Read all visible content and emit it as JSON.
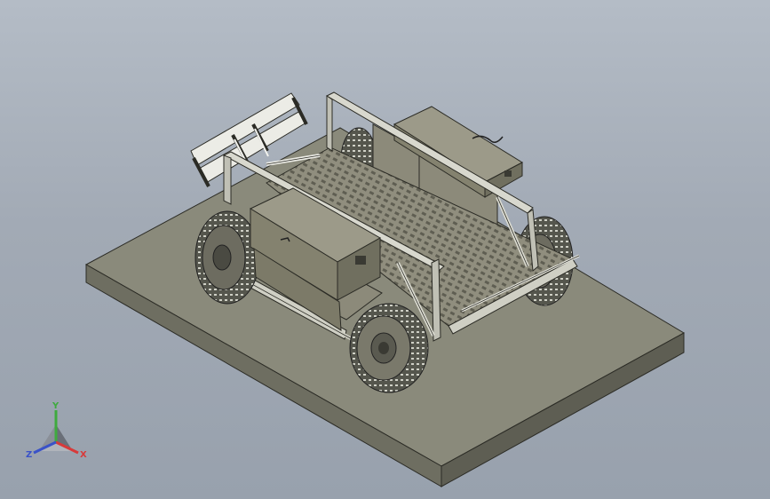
{
  "viewport": {
    "background_top": "#b4bcc6",
    "background_bottom": "#98a1ad"
  },
  "model": {
    "base_plate_color": "#8a8a7b",
    "body_color": "#8c8a7a",
    "frame_color": "#e7e7e0",
    "tire_color": "#55564d",
    "tread_color": "#cfd0c6"
  },
  "triad": {
    "x_label": "X",
    "y_label": "Y",
    "z_label": "Z",
    "x_color": "#d83a3a",
    "y_color": "#3faa3f",
    "z_color": "#3a52c8"
  }
}
